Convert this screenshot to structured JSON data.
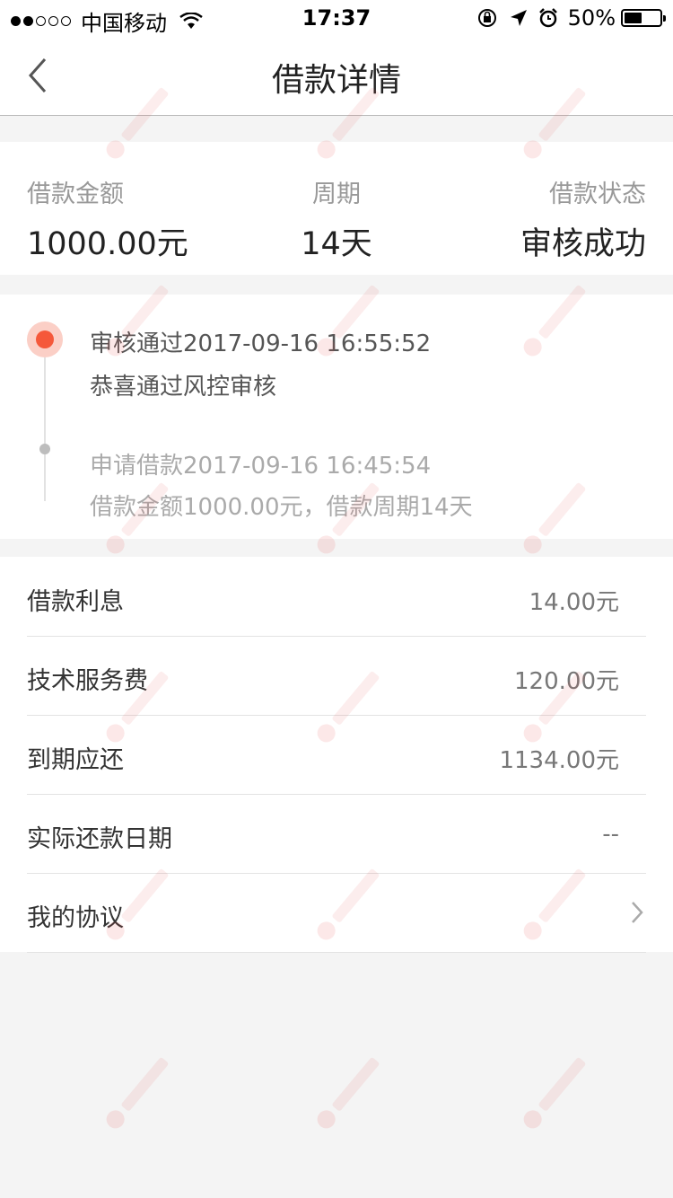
{
  "status_bar": {
    "carrier": "中国移动",
    "time": "17:37",
    "battery": "50%",
    "battery_fraction": 0.5,
    "signal_full": 2,
    "signal_total": 5
  },
  "nav": {
    "title": "借款详情",
    "back_icon": "chevron-left-icon"
  },
  "summary": {
    "amount_label": "借款金额",
    "amount_value": "1000.00元",
    "period_label": "周期",
    "period_value": "14天",
    "status_label": "借款状态",
    "status_value": "审核成功"
  },
  "timeline": [
    {
      "title": "审核通过2017-09-16 16:55:52",
      "desc": "恭喜通过风控审核"
    },
    {
      "title": "申请借款2017-09-16 16:45:54",
      "desc": "借款金额1000.00元，借款周期14天"
    }
  ],
  "details": [
    {
      "label": "借款利息",
      "value": "14.00元"
    },
    {
      "label": "技术服务费",
      "value": "120.00元"
    },
    {
      "label": "到期应还",
      "value": "1134.00元"
    },
    {
      "label": "实际还款日期",
      "value": "--"
    },
    {
      "label": "我的协议",
      "value": ""
    }
  ],
  "colors": {
    "accent": "#f5583a",
    "accent_light": "#fbcfc6",
    "background": "#f4f4f4"
  }
}
